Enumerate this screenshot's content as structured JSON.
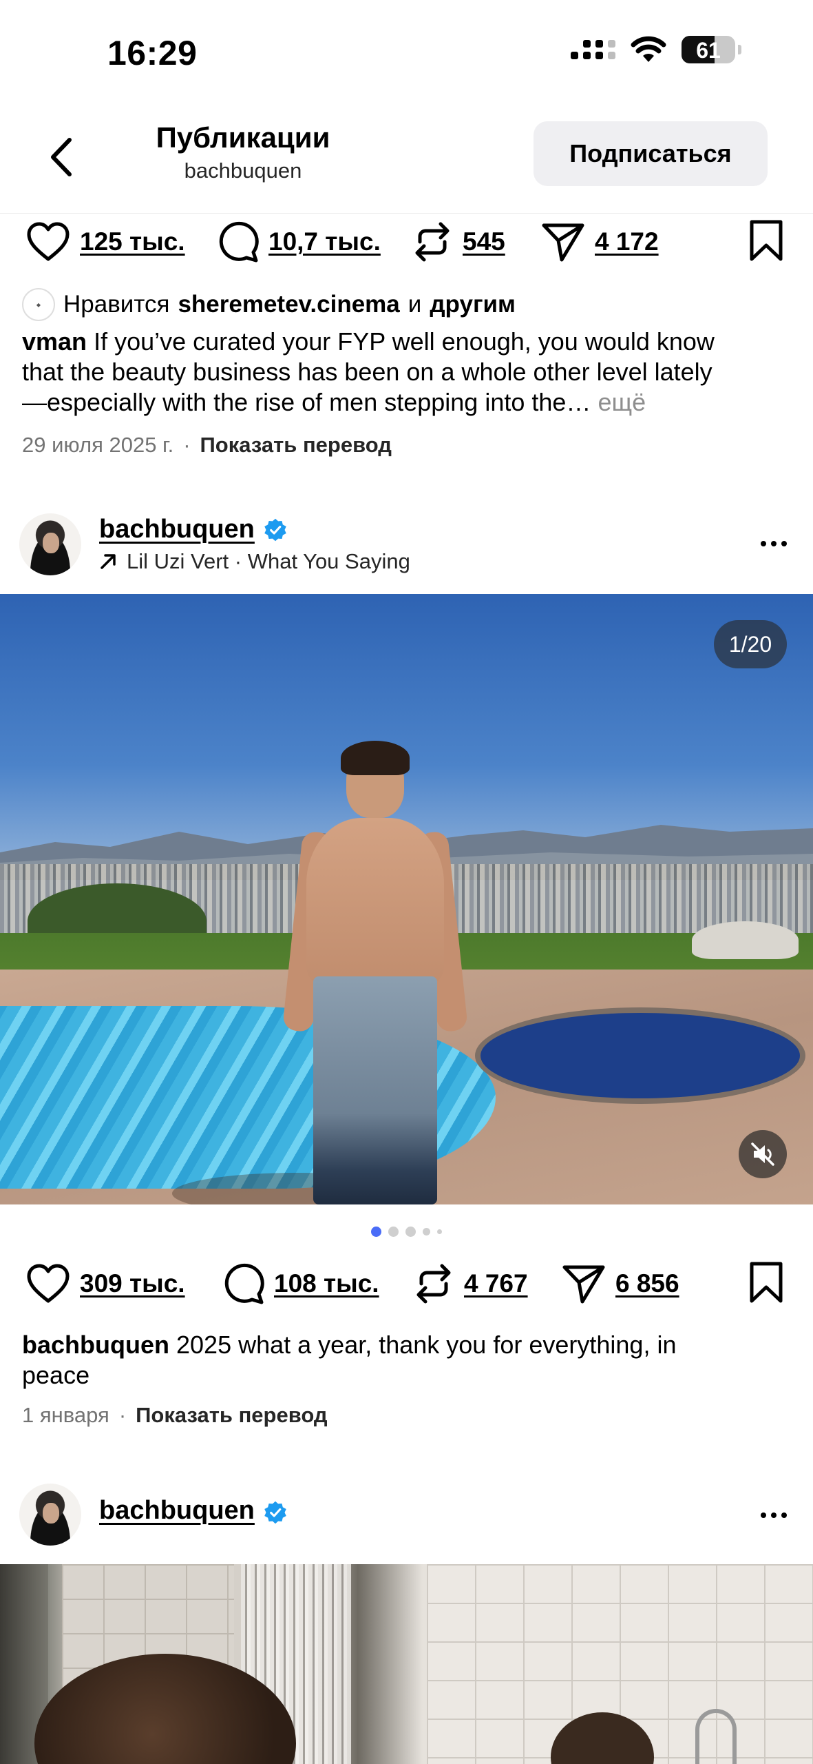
{
  "status_bar": {
    "time": "16:29",
    "battery": "61",
    "battery_level": 0.61
  },
  "header": {
    "title": "Публикации",
    "subtitle": "bachbuquen",
    "follow_label": "Подписаться"
  },
  "post_prev": {
    "likes": "125 тыс.",
    "comments": "10,7 тыс.",
    "reposts": "545",
    "shares": "4 172",
    "liked_by_prefix": "Нравится",
    "liked_by_user": "sheremetev.cinema",
    "liked_by_and": "и",
    "liked_by_others": "другим",
    "caption_user": "vman",
    "caption_line1": "If you’ve curated your FYP well enough, you would know",
    "caption_line2": "that the beauty business has been on a whole other level lately",
    "caption_line3": "—especially with the rise of men stepping into the…",
    "more": "ещё",
    "date": "29 июля 2025 г.",
    "translate": "Показать перевод"
  },
  "post_main": {
    "username": "bachbuquen",
    "music": "Lil Uzi Vert · What You Saying",
    "counter": "1/20",
    "likes": "309 тыс.",
    "comments": "108 тыс.",
    "reposts": "4 767",
    "shares": "6 856",
    "caption_user": "bachbuquen",
    "caption_line1": "2025 what a year, thank you for everything, in",
    "caption_line2": "peace",
    "date": "1 января",
    "translate": "Показать перевод"
  },
  "post_next": {
    "username": "bachbuquen"
  },
  "icons": {
    "like": "heart-icon",
    "comment": "comment-icon",
    "repost": "repost-icon",
    "share": "share-icon",
    "save": "bookmark-icon",
    "back": "chevron-left-icon",
    "verified": "verified-badge-icon",
    "music": "arrow-up-right-icon",
    "mute": "speaker-muted-icon"
  },
  "colors": {
    "verified": "#1d9bf0",
    "active_dot": "#4a6cf7"
  }
}
